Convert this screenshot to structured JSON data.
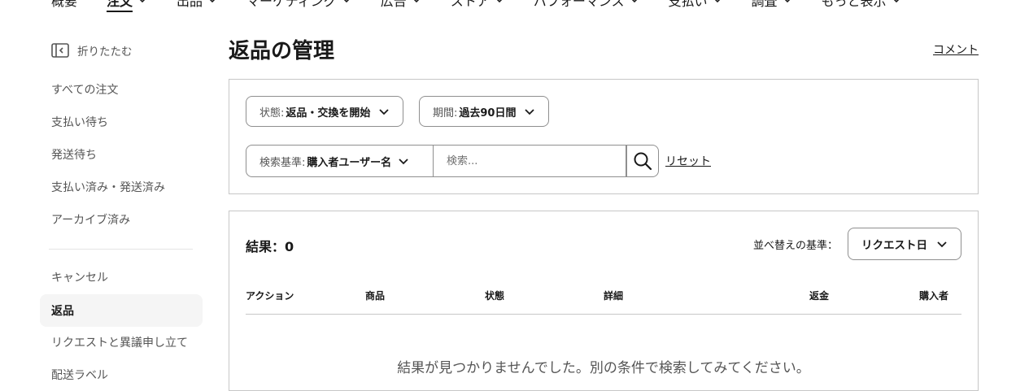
{
  "topnav": {
    "items": [
      {
        "label": "概要",
        "has_menu": false
      },
      {
        "label": "注文",
        "has_menu": true,
        "active": true
      },
      {
        "label": "出品",
        "has_menu": true
      },
      {
        "label": "マーケティング",
        "has_menu": true
      },
      {
        "label": "広告",
        "has_menu": true
      },
      {
        "label": "ストア",
        "has_menu": true
      },
      {
        "label": "パフォーマンス",
        "has_menu": true
      },
      {
        "label": "支払い",
        "has_menu": true
      },
      {
        "label": "調査",
        "has_menu": true
      },
      {
        "label": "もっと表示",
        "has_menu": true
      }
    ]
  },
  "sidebar": {
    "collapse_label": "折りたたむ",
    "items": [
      {
        "label": "すべての注文"
      },
      {
        "label": "支払い待ち"
      },
      {
        "label": "発送待ち"
      },
      {
        "label": "支払い済み・発送済み"
      },
      {
        "label": "アーカイブ済み"
      },
      {
        "label": "キャンセル"
      },
      {
        "label": "返品",
        "active": true
      },
      {
        "label": "リクエストと異議申し立て"
      },
      {
        "label": "配送ラベル"
      }
    ]
  },
  "main": {
    "title": "返品の管理",
    "comment_link": "コメント",
    "filters": {
      "status_label": "状態:",
      "status_value": "返品・交換を開始",
      "period_label": "期間:",
      "period_value": "過去90日間",
      "search_by_label": "検索基準:",
      "search_by_value": "購入者ユーザー名",
      "search_placeholder": "検索...",
      "search_value": "",
      "reset_label": "リセット"
    },
    "results": {
      "count_text": "結果：0",
      "sort_label": "並べ替えの基準：",
      "sort_value": "リクエスト日",
      "columns": [
        "アクション",
        "商品",
        "状態",
        "詳細",
        "返金",
        "購入者"
      ],
      "empty_message": "結果が見つかりませんでした。別の条件で検索してみてください。"
    }
  }
}
